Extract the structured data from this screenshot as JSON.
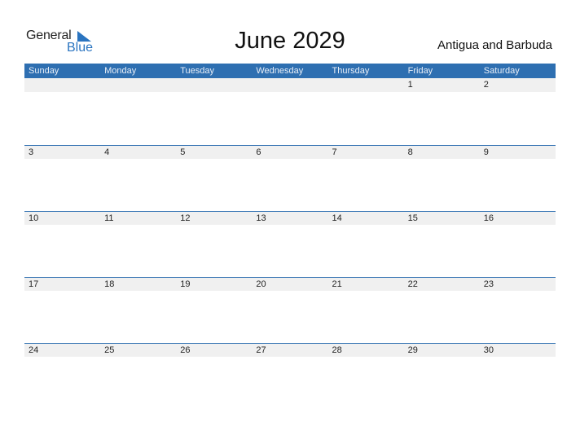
{
  "logo": {
    "word1": "General",
    "word2": "Blue"
  },
  "title": "June 2029",
  "country": "Antigua and Barbuda",
  "weekdays": [
    "Sunday",
    "Monday",
    "Tuesday",
    "Wednesday",
    "Thursday",
    "Friday",
    "Saturday"
  ],
  "weeks": [
    [
      "",
      "",
      "",
      "",
      "",
      "1",
      "2"
    ],
    [
      "3",
      "4",
      "5",
      "6",
      "7",
      "8",
      "9"
    ],
    [
      "10",
      "11",
      "12",
      "13",
      "14",
      "15",
      "16"
    ],
    [
      "17",
      "18",
      "19",
      "20",
      "21",
      "22",
      "23"
    ],
    [
      "24",
      "25",
      "26",
      "27",
      "28",
      "29",
      "30"
    ]
  ],
  "colors": {
    "accent": "#2e6fb1",
    "band": "#f0f0f0"
  }
}
